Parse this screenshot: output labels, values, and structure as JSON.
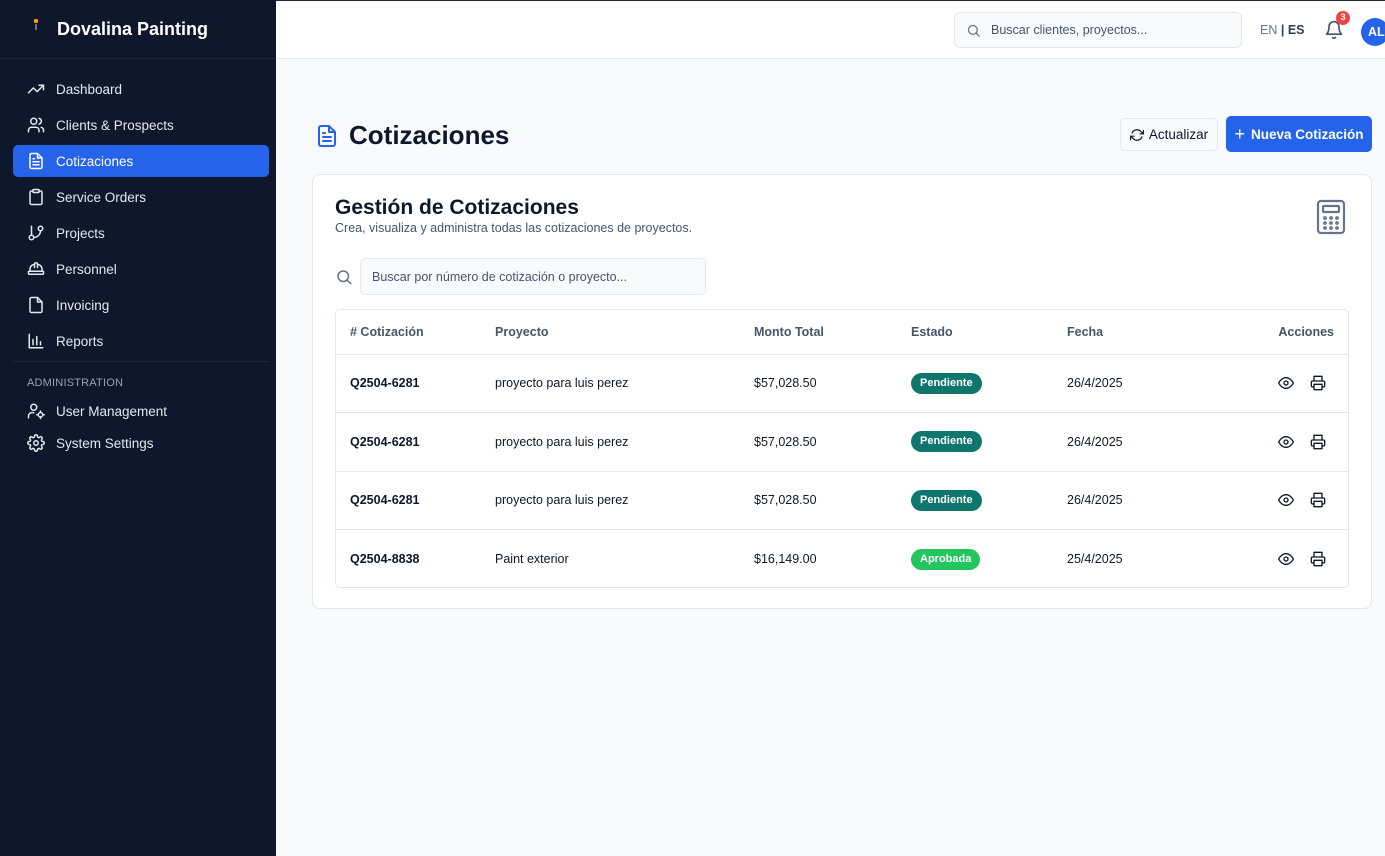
{
  "sidebar": {
    "brand": "Dovalina Painting",
    "items": [
      {
        "label": "Dashboard",
        "icon": "trending-up-icon",
        "active": false
      },
      {
        "label": "Clients & Prospects",
        "icon": "users-icon",
        "active": false
      },
      {
        "label": "Cotizaciones",
        "icon": "file-text-icon",
        "active": true
      },
      {
        "label": "Service Orders",
        "icon": "clipboard-icon",
        "active": false
      },
      {
        "label": "Projects",
        "icon": "git-branch-icon",
        "active": false
      },
      {
        "label": "Personnel",
        "icon": "hard-hat-icon",
        "active": false
      },
      {
        "label": "Invoicing",
        "icon": "file-icon",
        "active": false
      },
      {
        "label": "Reports",
        "icon": "bar-chart-icon",
        "active": false
      }
    ],
    "admin_section": "ADMINISTRATION",
    "admin_items": [
      {
        "label": "User Management",
        "icon": "user-cog-icon"
      },
      {
        "label": "System Settings",
        "icon": "gear-icon"
      }
    ]
  },
  "header": {
    "search_placeholder": "Buscar clientes, proyectos...",
    "lang_en": "EN",
    "lang_sep": "|",
    "lang_es": "ES",
    "notification_count": "3",
    "avatar_initials": "AL"
  },
  "page": {
    "title": "Cotizaciones",
    "refresh_label": "Actualizar",
    "new_label": "Nueva Cotización"
  },
  "card": {
    "title": "Gestión de Cotizaciones",
    "subtitle": "Crea, visualiza y administra todas las cotizaciones de proyectos.",
    "search_placeholder": "Buscar por número de cotización o proyecto..."
  },
  "table": {
    "headers": [
      "# Cotización",
      "Proyecto",
      "Monto Total",
      "Estado",
      "Fecha",
      "Acciones"
    ],
    "rows": [
      {
        "id": "Q2504-6281",
        "project": "proyecto para luis perez",
        "amount": "$57,028.50",
        "status": "Pendiente",
        "date": "26/4/2025"
      },
      {
        "id": "Q2504-6281",
        "project": "proyecto para luis perez",
        "amount": "$57,028.50",
        "status": "Pendiente",
        "date": "26/4/2025"
      },
      {
        "id": "Q2504-6281",
        "project": "proyecto para luis perez",
        "amount": "$57,028.50",
        "status": "Pendiente",
        "date": "26/4/2025"
      },
      {
        "id": "Q2504-8838",
        "project": "Paint exterior",
        "amount": "$16,149.00",
        "status": "Aprobada",
        "date": "25/4/2025"
      }
    ]
  },
  "colors": {
    "sidebar_bg": "#0f172a",
    "accent": "#2563eb",
    "status_pendiente": "#0f766e",
    "status_aprobada": "#22c55e",
    "notification": "#ef4444"
  }
}
